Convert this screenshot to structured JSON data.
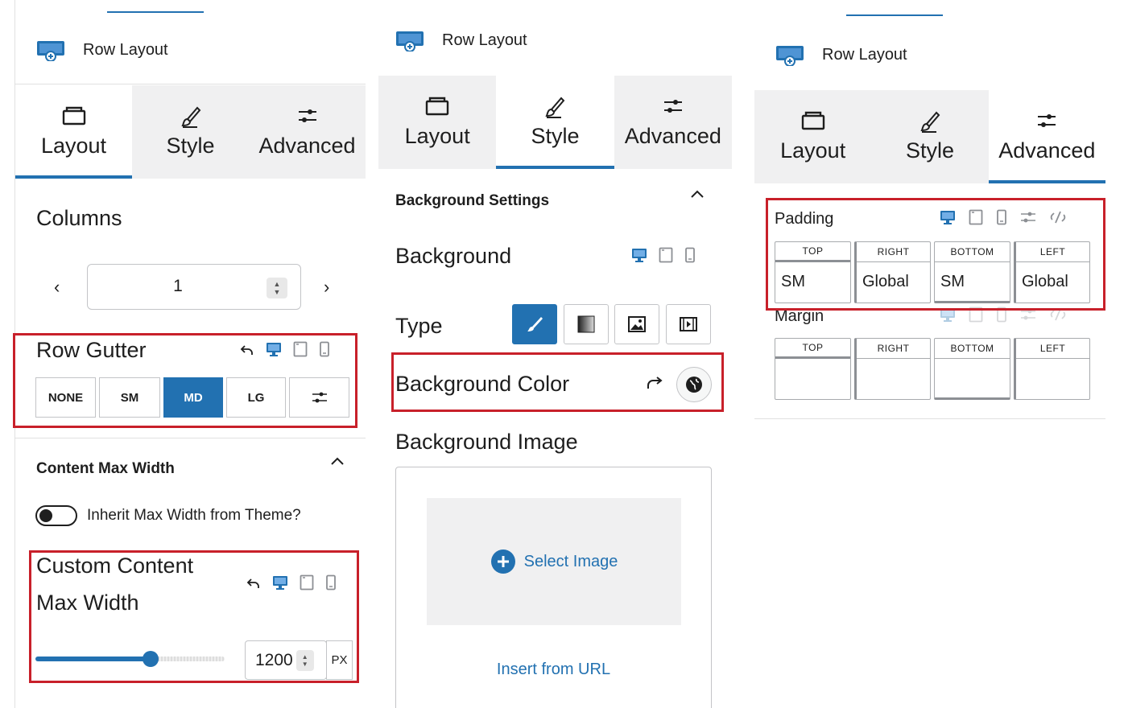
{
  "colors": {
    "accent": "#2271b1",
    "highlight": "#c8202a",
    "tab_bg": "#f0f0f1"
  },
  "panel1": {
    "title": "Row Layout",
    "tabs": [
      {
        "label": "Layout",
        "icon": "layout-icon",
        "active": true
      },
      {
        "label": "Style",
        "icon": "brush-icon",
        "active": false
      },
      {
        "label": "Advanced",
        "icon": "sliders-icon",
        "active": false
      }
    ],
    "columns": {
      "label": "Columns",
      "value": "1"
    },
    "row_gutter": {
      "label": "Row Gutter",
      "options": [
        "NONE",
        "SM",
        "MD",
        "LG"
      ],
      "selected": "MD"
    },
    "content_max_width": {
      "section_title": "Content Max Width",
      "inherit_label": "Inherit Max Width from Theme?",
      "inherit_enabled": false,
      "custom_label_line1": "Custom Content",
      "custom_label_line2": "Max Width",
      "value": "1200",
      "unit": "PX",
      "slider_fraction": 0.61
    }
  },
  "panel2": {
    "title": "Row Layout",
    "tabs": [
      {
        "label": "Layout",
        "icon": "layout-icon",
        "active": false
      },
      {
        "label": "Style",
        "icon": "brush-icon",
        "active": true
      },
      {
        "label": "Advanced",
        "icon": "sliders-icon",
        "active": false
      }
    ],
    "background_settings": {
      "section_title": "Background Settings",
      "background_label": "Background",
      "type_label": "Type",
      "types": [
        "color",
        "gradient",
        "image",
        "video"
      ],
      "selected_type": "color",
      "background_color_label": "Background Color",
      "background_image_label": "Background Image",
      "select_image": "Select Image",
      "insert_from_url": "Insert from URL"
    }
  },
  "panel3": {
    "title": "Row Layout",
    "tabs": [
      {
        "label": "Layout",
        "icon": "layout-icon",
        "active": false
      },
      {
        "label": "Style",
        "icon": "brush-icon",
        "active": false
      },
      {
        "label": "Advanced",
        "icon": "sliders-icon",
        "active": true
      }
    ],
    "padding": {
      "label": "Padding",
      "sides": [
        "TOP",
        "RIGHT",
        "BOTTOM",
        "LEFT"
      ],
      "values": [
        "SM",
        "Global",
        "SM",
        "Global"
      ]
    },
    "margin": {
      "label": "Margin",
      "sides": [
        "TOP",
        "RIGHT",
        "BOTTOM",
        "LEFT"
      ],
      "values": [
        "",
        "",
        "",
        ""
      ]
    }
  }
}
